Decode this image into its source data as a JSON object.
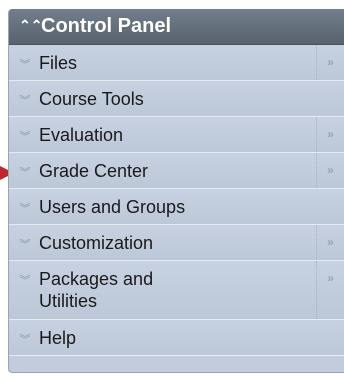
{
  "control_panel": {
    "title": "Control Panel",
    "items": [
      {
        "label": "Files",
        "has_submenu": true
      },
      {
        "label": "Course Tools",
        "has_submenu": false
      },
      {
        "label": "Evaluation",
        "has_submenu": true
      },
      {
        "label": "Grade Center",
        "has_submenu": true
      },
      {
        "label": "Users and Groups",
        "has_submenu": false
      },
      {
        "label": "Customization",
        "has_submenu": true
      },
      {
        "label": "Packages and\nUtilities",
        "has_submenu": true
      },
      {
        "label": "Help",
        "has_submenu": false
      }
    ]
  },
  "icons": {
    "header_collapse": "chevron-up-double-icon",
    "item_expand": "chevron-down-double-icon",
    "submenu": "chevron-right-double-icon",
    "pointer_arrow_color": "#c0262c"
  }
}
